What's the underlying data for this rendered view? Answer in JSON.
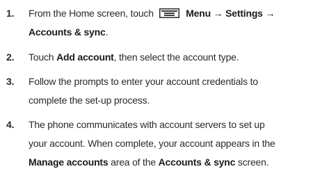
{
  "steps": [
    {
      "number": "1.",
      "lines": [
        {
          "pre": "From the Home screen, touch",
          "icon": "menu-icon",
          "bold1": "Menu → Settings →"
        },
        {
          "bold1": "Accounts & sync",
          "post": "."
        }
      ]
    },
    {
      "number": "2.",
      "lines": [
        {
          "pre": "Touch ",
          "bold1": "Add account",
          "post": ", then select the account type."
        }
      ]
    },
    {
      "number": "3.",
      "lines": [
        {
          "pre": "Follow the prompts to enter your account credentials to"
        },
        {
          "pre": "complete the set-up process."
        }
      ]
    },
    {
      "number": "4.",
      "lines": [
        {
          "pre": "The phone communicates with account servers to set up"
        },
        {
          "pre": "your account. When complete, your account appears in the"
        },
        {
          "bold1": "Manage accounts",
          "mid": " area of the ",
          "bold2": "Accounts & sync",
          "post": " screen."
        }
      ]
    }
  ]
}
